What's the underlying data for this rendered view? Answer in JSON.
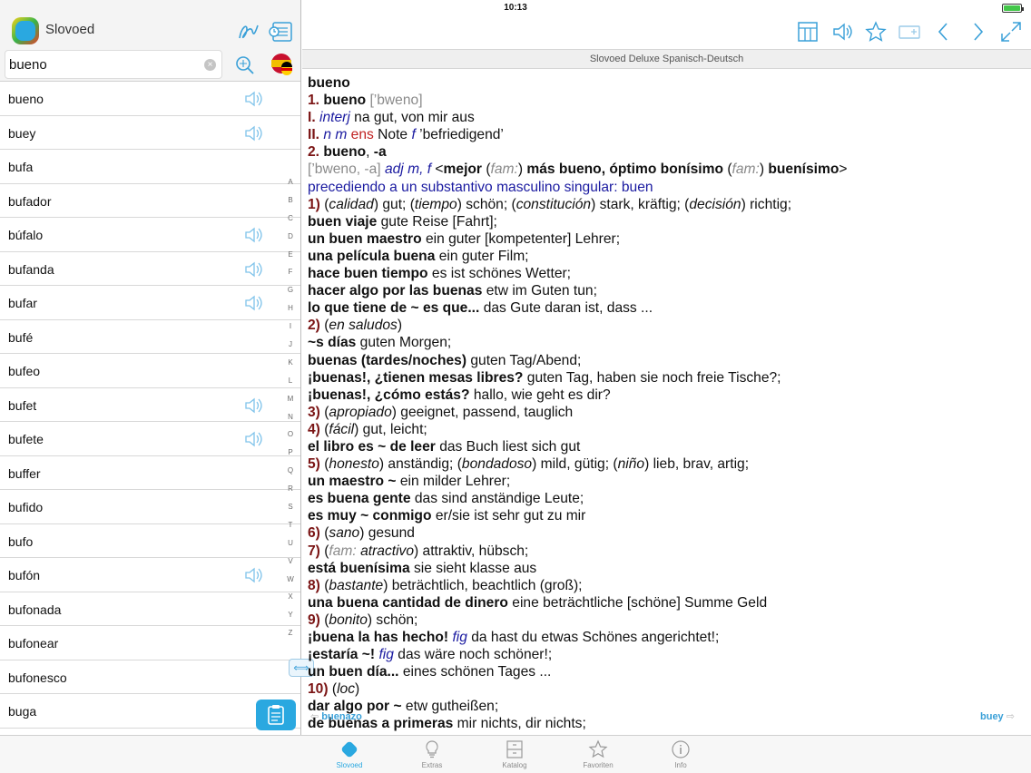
{
  "status": {
    "time": "10:13"
  },
  "app": {
    "name": "Slovoed"
  },
  "search": {
    "value": "bueno",
    "placeholder": ""
  },
  "dictionary": {
    "title": "Slovoed Deluxe Spanisch-Deutsch"
  },
  "words": [
    {
      "w": "bueno",
      "audio": true
    },
    {
      "w": "buey",
      "audio": true
    },
    {
      "w": "bufa",
      "audio": false
    },
    {
      "w": "bufador",
      "audio": false
    },
    {
      "w": "búfalo",
      "audio": true
    },
    {
      "w": "bufanda",
      "audio": true
    },
    {
      "w": "bufar",
      "audio": true
    },
    {
      "w": "bufé",
      "audio": false
    },
    {
      "w": "bufeo",
      "audio": false
    },
    {
      "w": "bufet",
      "audio": true
    },
    {
      "w": "bufete",
      "audio": true
    },
    {
      "w": "buffer",
      "audio": false
    },
    {
      "w": "bufido",
      "audio": false
    },
    {
      "w": "bufo",
      "audio": false
    },
    {
      "w": "bufón",
      "audio": true
    },
    {
      "w": "bufonada",
      "audio": false
    },
    {
      "w": "bufonear",
      "audio": false
    },
    {
      "w": "bufonesco",
      "audio": false
    },
    {
      "w": "buga",
      "audio": false
    }
  ],
  "alphabet": [
    "A",
    "B",
    "C",
    "D",
    "E",
    "F",
    "G",
    "H",
    "I",
    "J",
    "K",
    "L",
    "M",
    "N",
    "O",
    "P",
    "Q",
    "R",
    "S",
    "T",
    "U",
    "V",
    "W",
    "X",
    "Y",
    "Z"
  ],
  "article": {
    "headword": "bueno",
    "lines": [
      [
        [
          "b",
          "bueno"
        ]
      ],
      [
        [
          "num",
          "1. "
        ],
        [
          "b",
          "bueno "
        ],
        [
          "gr",
          "[’bweno]"
        ]
      ],
      [
        [
          "num",
          "I. "
        ],
        [
          "bl",
          "interj "
        ],
        [
          "t",
          "na gut, von mir aus"
        ]
      ],
      [
        [
          "num",
          "II. "
        ],
        [
          "bl",
          "n m "
        ],
        [
          "red",
          "ens "
        ],
        [
          "t",
          "Note "
        ],
        [
          "bl",
          "f "
        ],
        [
          "t",
          "’befriedigend’"
        ]
      ],
      [
        [
          "num",
          "2. "
        ],
        [
          "b",
          "bueno"
        ],
        [
          "t",
          ", "
        ],
        [
          "b",
          "-a"
        ]
      ],
      [
        [
          "gr",
          "[’bweno, -a] "
        ],
        [
          "bl",
          "adj m, f "
        ],
        [
          "t",
          "<"
        ],
        [
          "b",
          "mejor "
        ],
        [
          "t",
          "("
        ],
        [
          "gi",
          "fam:"
        ],
        [
          "t",
          ") "
        ],
        [
          "b",
          "más bueno, óptimo bonísimo "
        ],
        [
          "t",
          "("
        ],
        [
          "gi",
          "fam:"
        ],
        [
          "t",
          ") "
        ],
        [
          "b",
          "buenísimo"
        ],
        [
          "t",
          ">"
        ]
      ],
      [
        [
          "blr",
          "precediendo a un substantivo masculino singular: buen"
        ]
      ],
      [
        [
          "num",
          "1) "
        ],
        [
          "t",
          "("
        ],
        [
          "i",
          "calidad"
        ],
        [
          "t",
          ") gut; ("
        ],
        [
          "i",
          "tiempo"
        ],
        [
          "t",
          ") schön; ("
        ],
        [
          "i",
          "constitución"
        ],
        [
          "t",
          ") stark, kräftig; ("
        ],
        [
          "i",
          "decisión"
        ],
        [
          "t",
          ") richtig;"
        ]
      ],
      [
        [
          "b",
          "buen viaje "
        ],
        [
          "t",
          "gute Reise [Fahrt];"
        ]
      ],
      [
        [
          "b",
          "un buen maestro "
        ],
        [
          "t",
          "ein guter [kompetenter] Lehrer;"
        ]
      ],
      [
        [
          "b",
          "una película buena "
        ],
        [
          "t",
          "ein guter Film;"
        ]
      ],
      [
        [
          "b",
          "hace buen tiempo "
        ],
        [
          "t",
          "es ist schönes Wetter;"
        ]
      ],
      [
        [
          "b",
          "hacer algo por las buenas "
        ],
        [
          "t",
          "etw im Guten tun;"
        ]
      ],
      [
        [
          "b",
          "lo que tiene de ~ es que... "
        ],
        [
          "t",
          "das Gute daran ist, dass ..."
        ]
      ],
      [
        [
          "num",
          "2) "
        ],
        [
          "t",
          "("
        ],
        [
          "i",
          "en saludos"
        ],
        [
          "t",
          ")"
        ]
      ],
      [
        [
          "b",
          "~s días "
        ],
        [
          "t",
          "guten Morgen;"
        ]
      ],
      [
        [
          "b",
          "buenas (tardes/noches) "
        ],
        [
          "t",
          "guten Tag/Abend;"
        ]
      ],
      [
        [
          "b",
          "¡buenas!, ¿tienen mesas libres? "
        ],
        [
          "t",
          "guten Tag, haben sie noch freie Tische?;"
        ]
      ],
      [
        [
          "b",
          "¡buenas!, ¿cómo estás? "
        ],
        [
          "t",
          "hallo, wie geht es dir?"
        ]
      ],
      [
        [
          "num",
          "3) "
        ],
        [
          "t",
          "("
        ],
        [
          "i",
          "apropiado"
        ],
        [
          "t",
          ") geeignet, passend, tauglich"
        ]
      ],
      [
        [
          "num",
          "4) "
        ],
        [
          "t",
          "("
        ],
        [
          "i",
          "fácil"
        ],
        [
          "t",
          ") gut, leicht;"
        ]
      ],
      [
        [
          "b",
          "el libro es ~ de leer "
        ],
        [
          "t",
          "das Buch liest sich gut"
        ]
      ],
      [
        [
          "num",
          "5) "
        ],
        [
          "t",
          "("
        ],
        [
          "i",
          "honesto"
        ],
        [
          "t",
          ") anständig; ("
        ],
        [
          "i",
          "bondadoso"
        ],
        [
          "t",
          ") mild, gütig; ("
        ],
        [
          "i",
          "niño"
        ],
        [
          "t",
          ") lieb, brav, artig;"
        ]
      ],
      [
        [
          "b",
          "un maestro ~ "
        ],
        [
          "t",
          "ein milder Lehrer;"
        ]
      ],
      [
        [
          "b",
          "es buena gente "
        ],
        [
          "t",
          "das sind anständige Leute;"
        ]
      ],
      [
        [
          "b",
          "es muy ~ conmigo "
        ],
        [
          "t",
          "er/sie ist sehr gut zu mir"
        ]
      ],
      [
        [
          "num",
          "6) "
        ],
        [
          "t",
          "("
        ],
        [
          "i",
          "sano"
        ],
        [
          "t",
          ") gesund"
        ]
      ],
      [
        [
          "num",
          "7) "
        ],
        [
          "t",
          "("
        ],
        [
          "gi",
          "fam: "
        ],
        [
          "i",
          "atractivo"
        ],
        [
          "t",
          ") attraktiv, hübsch;"
        ]
      ],
      [
        [
          "b",
          "está buenísima "
        ],
        [
          "t",
          "sie sieht klasse aus"
        ]
      ],
      [
        [
          "num",
          "8) "
        ],
        [
          "t",
          "("
        ],
        [
          "i",
          "bastante"
        ],
        [
          "t",
          ") beträchtlich, beachtlich (groß);"
        ]
      ],
      [
        [
          "b",
          "una buena cantidad de dinero "
        ],
        [
          "t",
          "eine beträchtliche [schöne] Summe Geld"
        ]
      ],
      [
        [
          "num",
          "9) "
        ],
        [
          "t",
          "("
        ],
        [
          "i",
          "bonito"
        ],
        [
          "t",
          ") schön;"
        ]
      ],
      [
        [
          "b",
          "¡buena la has hecho! "
        ],
        [
          "bl",
          "fig "
        ],
        [
          "t",
          "da hast du etwas Schönes angerichtet!;"
        ]
      ],
      [
        [
          "b",
          "¡estaría ~! "
        ],
        [
          "bl",
          "fig "
        ],
        [
          "t",
          "das wäre noch schöner!;"
        ]
      ],
      [
        [
          "b",
          "un buen día... "
        ],
        [
          "t",
          "eines schönen Tages ..."
        ]
      ],
      [
        [
          "num",
          "10) "
        ],
        [
          "t",
          "("
        ],
        [
          "i",
          "loc"
        ],
        [
          "t",
          ")"
        ]
      ],
      [
        [
          "b",
          "dar algo por ~ "
        ],
        [
          "t",
          "etw gutheißen;"
        ]
      ],
      [
        [
          "b",
          "de buenas a primeras "
        ],
        [
          "t",
          "mir nichts, dir nichts;"
        ]
      ]
    ]
  },
  "nav": {
    "prev": "buenazo",
    "next": "buey"
  },
  "tabs": [
    {
      "label": "Slovoed",
      "icon": "slovoed-icon",
      "active": true
    },
    {
      "label": "Extras",
      "icon": "bulb-icon",
      "active": false
    },
    {
      "label": "Katalog",
      "icon": "catalog-icon",
      "active": false
    },
    {
      "label": "Favoriten",
      "icon": "star-icon",
      "active": false
    },
    {
      "label": "Info",
      "icon": "info-icon",
      "active": false
    }
  ],
  "colors": {
    "accent": "#2aa8e0",
    "number": "#7a1414",
    "grammar": "#1a1aa0",
    "pron": "#8a8a8a"
  }
}
